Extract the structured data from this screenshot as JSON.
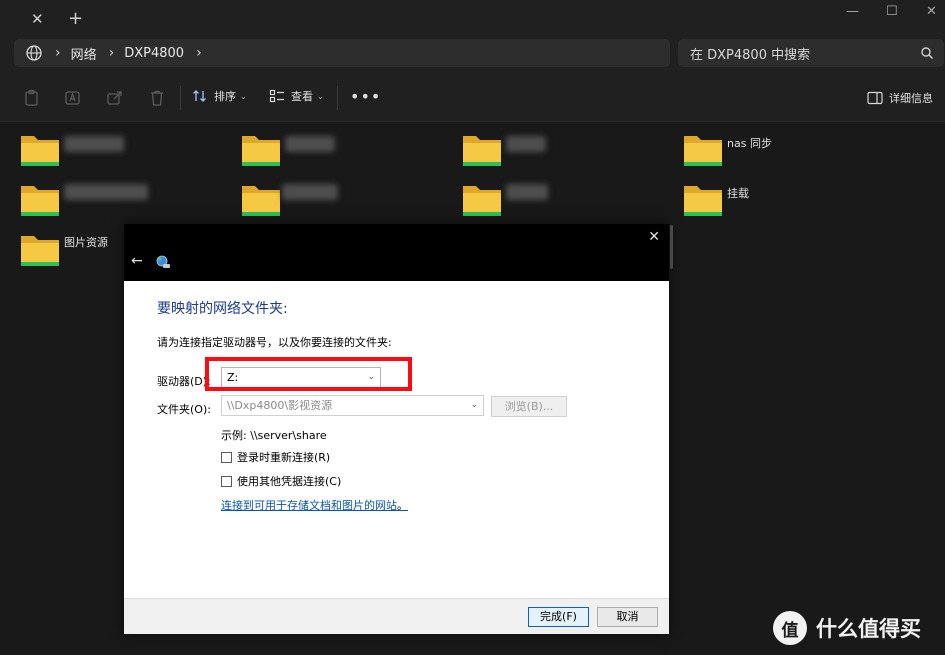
{
  "titlebar": {
    "close_glyph": "✕",
    "add_glyph": "+",
    "minimize_glyph": "—",
    "maximize_glyph": "☐",
    "window_close_glyph": "✕"
  },
  "address_bar": {
    "icon": "globe-icon",
    "separator": "›",
    "crumbs": [
      "网络",
      "DXP4800"
    ],
    "search_placeholder": "在 DXP4800 中搜索"
  },
  "command_bar": {
    "sort_label": "排序",
    "view_label": "查看",
    "more_glyph": "•••",
    "details_label": "详细信息",
    "chevron": "⌄"
  },
  "folders": [
    {
      "label": ""
    },
    {
      "label": ""
    },
    {
      "label": ""
    },
    {
      "label": "nas 同步"
    },
    {
      "label": ""
    },
    {
      "label": ""
    },
    {
      "label": ""
    },
    {
      "label": "挂载"
    },
    {
      "label": "图片资源"
    }
  ],
  "dialog": {
    "close_glyph": "✕",
    "back_glyph": "←",
    "heading": "要映射的网络文件夹:",
    "instruction": "请为连接指定驱动器号，以及你要连接的文件夹:",
    "drive_label": "驱动器(D):",
    "drive_value": "Z:",
    "folder_label": "文件夹(O):",
    "folder_value": "\\\\Dxp4800\\影视资源",
    "browse_label": "浏览(B)...",
    "example": "示例: \\\\server\\share",
    "reconnect_label": "登录时重新连接(R)",
    "other_credentials_label": "使用其他凭据连接(C)",
    "link_text": "连接到可用于存储文档和图片的网站",
    "link_suffix": "。",
    "finish_label": "完成(F)",
    "cancel_label": "取消",
    "dropdown_arrow": "⌄"
  },
  "watermark": {
    "text": "什么值得买",
    "logo_glyph": "值"
  },
  "colors": {
    "highlight_red": "#ff0a12",
    "folder_yellow": "#f6c944",
    "folder_green": "#2fbf5a",
    "heading_blue": "#1e3a8a",
    "link_blue": "#0a55b5"
  }
}
